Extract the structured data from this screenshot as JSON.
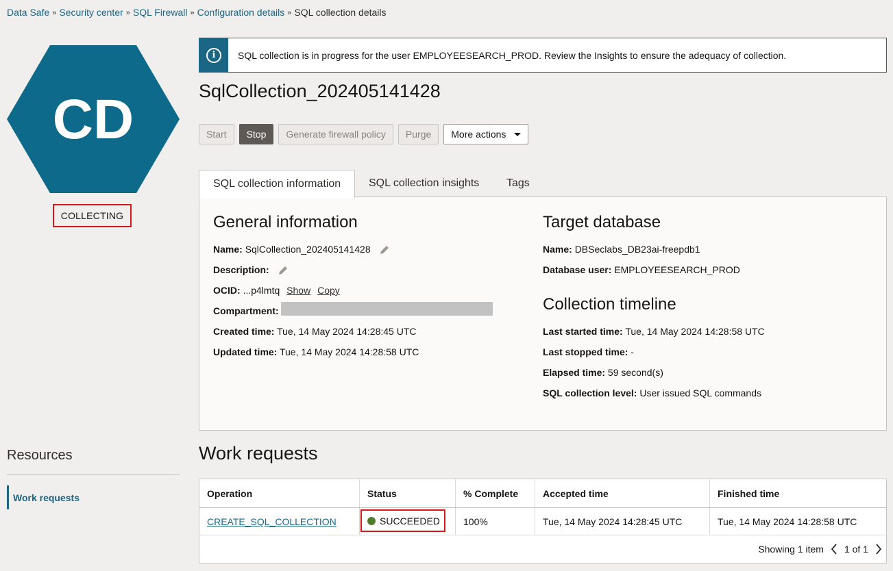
{
  "breadcrumb": {
    "items": [
      "Data Safe",
      "Security center",
      "SQL Firewall",
      "Configuration details"
    ],
    "current": "SQL collection details",
    "separator": "»"
  },
  "resource": {
    "initials": "CD",
    "status": "COLLECTING",
    "hex_color": "#0e6a8a"
  },
  "alert": {
    "icon": "info-icon",
    "message": "SQL collection is in progress for the user EMPLOYEESEARCH_PROD. Review the Insights to ensure the adequacy of collection."
  },
  "title": "SqlCollection_202405141428",
  "actions": {
    "start": "Start",
    "stop": "Stop",
    "generate": "Generate firewall policy",
    "purge": "Purge",
    "more": "More actions"
  },
  "tabs": [
    "SQL collection information",
    "SQL collection insights",
    "Tags"
  ],
  "general": {
    "heading": "General information",
    "name_label": "Name:",
    "name_value": "SqlCollection_202405141428",
    "description_label": "Description:",
    "ocid_label": "OCID:",
    "ocid_value": "...p4lmtq",
    "show": "Show",
    "copy": "Copy",
    "compartment_label": "Compartment:",
    "created_label": "Created time:",
    "created_value": "Tue, 14 May 2024 14:28:45 UTC",
    "updated_label": "Updated time:",
    "updated_value": "Tue, 14 May 2024 14:28:58 UTC"
  },
  "target": {
    "heading": "Target database",
    "name_label": "Name:",
    "name_value": "DBSeclabs_DB23ai-freepdb1",
    "dbuser_label": "Database user:",
    "dbuser_value": "EMPLOYEESEARCH_PROD"
  },
  "timeline": {
    "heading": "Collection timeline",
    "started_label": "Last started time:",
    "started_value": "Tue, 14 May 2024 14:28:58 UTC",
    "stopped_label": "Last stopped time:",
    "stopped_value": "-",
    "elapsed_label": "Elapsed time:",
    "elapsed_value": "59 second(s)",
    "level_label": "SQL collection level:",
    "level_value": "User issued SQL commands"
  },
  "resources": {
    "heading": "Resources",
    "item": "Work requests"
  },
  "work_requests": {
    "heading": "Work requests",
    "columns": [
      "Operation",
      "Status",
      "% Complete",
      "Accepted time",
      "Finished time"
    ],
    "rows": [
      {
        "operation": "CREATE_SQL_COLLECTION",
        "status": "SUCCEEDED",
        "complete": "100%",
        "accepted": "Tue, 14 May 2024 14:28:45 UTC",
        "finished": "Tue, 14 May 2024 14:28:58 UTC"
      }
    ],
    "showing": "Showing 1 item",
    "pager": "1 of 1"
  }
}
